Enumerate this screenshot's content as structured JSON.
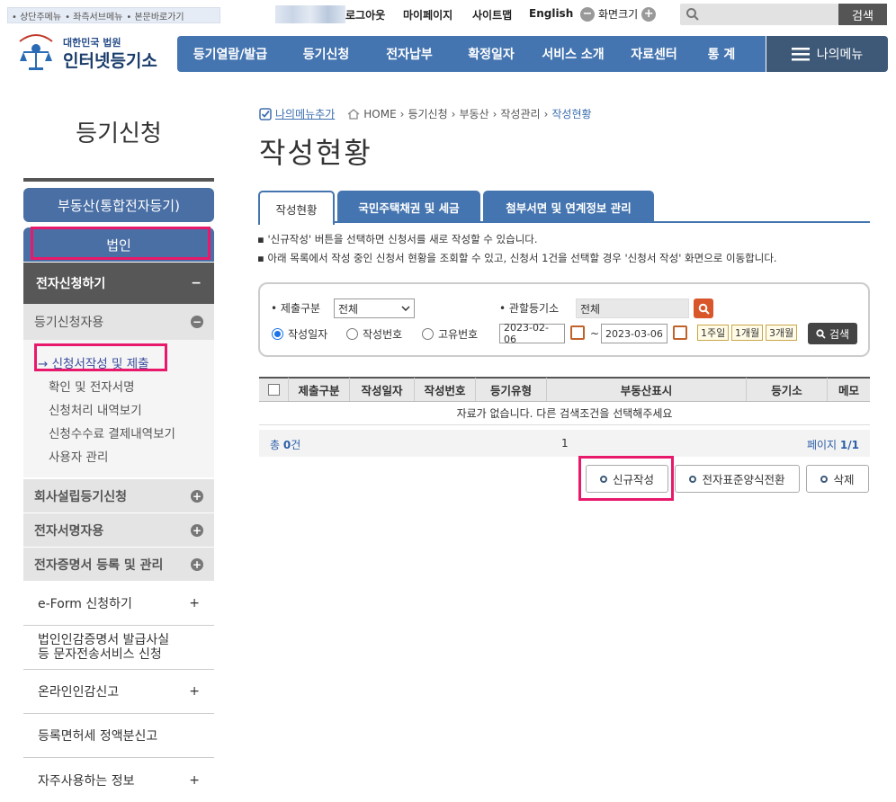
{
  "skip_links": [
    "상단주메뉴",
    "좌측서브메뉴",
    "본문바로가기"
  ],
  "top_links": {
    "logout": "로그아웃",
    "mypage": "마이페이지",
    "sitemap": "사이트맵",
    "english": "English",
    "zoom": "화면크기"
  },
  "search": {
    "button": "검색",
    "placeholder": ""
  },
  "logo": {
    "small": "대한민국 법원",
    "big": "인터넷등기소",
    "seal": "대 한 민 국 법 원"
  },
  "gnb": [
    "등기열람/발급",
    "등기신청",
    "전자납부",
    "확정일자",
    "서비스 소개",
    "자료센터",
    "통 계"
  ],
  "my_menu": "나의메뉴",
  "sidebar": {
    "title": "등기신청",
    "realty": "부동산(통합전자등기)",
    "corp": "법인",
    "elec": "전자신청하기",
    "sub_title": "등기신청자용",
    "sub_items": [
      "신청서작성 및 제출",
      "확인 및 전자서명",
      "신청처리 내역보기",
      "신청수수료 결제내역보기",
      "사용자 관리"
    ],
    "cats": [
      "회사설립등기신청",
      "전자서명자용",
      "전자증명서 등록 및 관리"
    ],
    "plain": [
      "e-Form 신청하기",
      "법인인감증명서 발급사실",
      "등 문자전송서비스 신청",
      "온라인인감신고",
      "등록면허세 정액분신고",
      "자주사용하는 정보"
    ],
    "minus": "−",
    "plus": "+"
  },
  "breadcrumb": {
    "add": "나의메뉴추가",
    "items": [
      "HOME",
      "등기신청",
      "부동산",
      "작성관리",
      "작성현황"
    ]
  },
  "page_title": "작성현황",
  "tabs": [
    "작성현황",
    "국민주택채권 및 세금",
    "첨부서면 및 연계정보 관리"
  ],
  "notes": [
    "'신규작성' 버튼을 선택하면 신청서를 새로 작성할 수 있습니다.",
    "아래 목록에서 작성 중인 신청서 현황을 조회할 수 있고, 신청서 1건을 선택할 경우 '신청서 작성' 화면으로 이동합니다."
  ],
  "filter": {
    "submit_label": "제출구분",
    "submit_value": "전체",
    "office_label": "관할등기소",
    "office_value": "전체",
    "radios": [
      "작성일자",
      "작성번호",
      "고유번호"
    ],
    "date_from": "2023-02-06",
    "date_to": "2023-03-06",
    "tilde": "~",
    "periods": [
      "1주일",
      "1개월",
      "3개월"
    ],
    "search": "검색"
  },
  "table": {
    "headers": [
      "제출구분",
      "작성일자",
      "작성번호",
      "등기유형",
      "부동산표시",
      "등기소",
      "메모"
    ],
    "empty": "자료가 없습니다. 다른 검색조건을 선택해주세요",
    "total_label": "총",
    "total_count": "0",
    "total_unit": "건",
    "page_num": "1",
    "page_label": "페이지",
    "page_value": "1/1"
  },
  "actions": [
    "신규작성",
    "전자표준양식전환",
    "삭제"
  ]
}
